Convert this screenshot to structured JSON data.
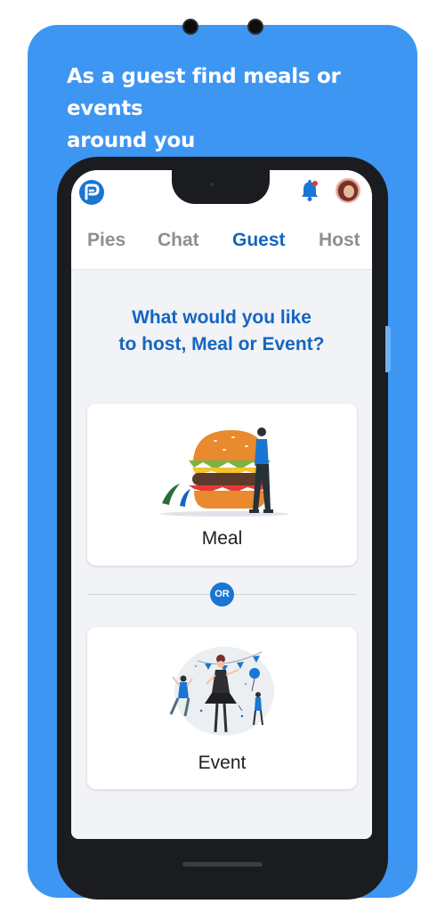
{
  "promo": {
    "headline_line1": "As a guest find meals or events",
    "headline_line2": "around you"
  },
  "header": {
    "logo_icon": "app-logo-icon",
    "notification_icon": "bell-icon",
    "avatar_icon": "user-avatar"
  },
  "tabs": [
    {
      "label": "Pies",
      "active": false
    },
    {
      "label": "Chat",
      "active": false
    },
    {
      "label": "Guest",
      "active": true
    },
    {
      "label": "Host",
      "active": false
    }
  ],
  "main": {
    "question_line1": "What would you like",
    "question_line2": "to host, Meal or Event?",
    "options": [
      {
        "label": "Meal",
        "illustration": "burger-illustration"
      },
      {
        "label": "Event",
        "illustration": "party-illustration"
      }
    ],
    "or_label": "OR"
  },
  "colors": {
    "background_panel": "#3d96f2",
    "accent": "#1565c0",
    "or_badge": "#1976d2",
    "tab_inactive": "#8c8f94"
  }
}
